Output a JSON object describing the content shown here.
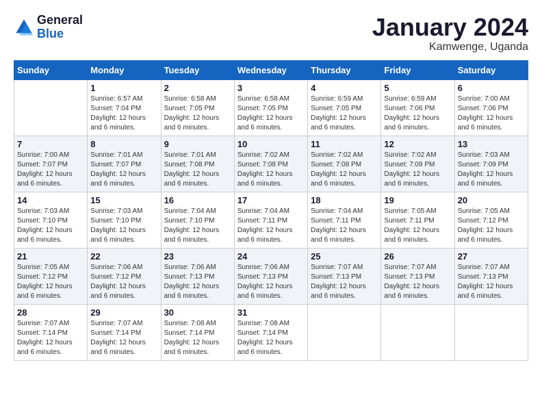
{
  "header": {
    "logo_line1": "General",
    "logo_line2": "Blue",
    "month_title": "January 2024",
    "location": "Kamwenge, Uganda"
  },
  "days_of_week": [
    "Sunday",
    "Monday",
    "Tuesday",
    "Wednesday",
    "Thursday",
    "Friday",
    "Saturday"
  ],
  "weeks": [
    [
      {
        "day": "",
        "info": ""
      },
      {
        "day": "1",
        "info": "Sunrise: 6:57 AM\nSunset: 7:04 PM\nDaylight: 12 hours\nand 6 minutes."
      },
      {
        "day": "2",
        "info": "Sunrise: 6:58 AM\nSunset: 7:05 PM\nDaylight: 12 hours\nand 6 minutes."
      },
      {
        "day": "3",
        "info": "Sunrise: 6:58 AM\nSunset: 7:05 PM\nDaylight: 12 hours\nand 6 minutes."
      },
      {
        "day": "4",
        "info": "Sunrise: 6:59 AM\nSunset: 7:05 PM\nDaylight: 12 hours\nand 6 minutes."
      },
      {
        "day": "5",
        "info": "Sunrise: 6:59 AM\nSunset: 7:06 PM\nDaylight: 12 hours\nand 6 minutes."
      },
      {
        "day": "6",
        "info": "Sunrise: 7:00 AM\nSunset: 7:06 PM\nDaylight: 12 hours\nand 6 minutes."
      }
    ],
    [
      {
        "day": "7",
        "info": "Sunrise: 7:00 AM\nSunset: 7:07 PM\nDaylight: 12 hours\nand 6 minutes."
      },
      {
        "day": "8",
        "info": "Sunrise: 7:01 AM\nSunset: 7:07 PM\nDaylight: 12 hours\nand 6 minutes."
      },
      {
        "day": "9",
        "info": "Sunrise: 7:01 AM\nSunset: 7:08 PM\nDaylight: 12 hours\nand 6 minutes."
      },
      {
        "day": "10",
        "info": "Sunrise: 7:02 AM\nSunset: 7:08 PM\nDaylight: 12 hours\nand 6 minutes."
      },
      {
        "day": "11",
        "info": "Sunrise: 7:02 AM\nSunset: 7:08 PM\nDaylight: 12 hours\nand 6 minutes."
      },
      {
        "day": "12",
        "info": "Sunrise: 7:02 AM\nSunset: 7:09 PM\nDaylight: 12 hours\nand 6 minutes."
      },
      {
        "day": "13",
        "info": "Sunrise: 7:03 AM\nSunset: 7:09 PM\nDaylight: 12 hours\nand 6 minutes."
      }
    ],
    [
      {
        "day": "14",
        "info": "Sunrise: 7:03 AM\nSunset: 7:10 PM\nDaylight: 12 hours\nand 6 minutes."
      },
      {
        "day": "15",
        "info": "Sunrise: 7:03 AM\nSunset: 7:10 PM\nDaylight: 12 hours\nand 6 minutes."
      },
      {
        "day": "16",
        "info": "Sunrise: 7:04 AM\nSunset: 7:10 PM\nDaylight: 12 hours\nand 6 minutes."
      },
      {
        "day": "17",
        "info": "Sunrise: 7:04 AM\nSunset: 7:11 PM\nDaylight: 12 hours\nand 6 minutes."
      },
      {
        "day": "18",
        "info": "Sunrise: 7:04 AM\nSunset: 7:11 PM\nDaylight: 12 hours\nand 6 minutes."
      },
      {
        "day": "19",
        "info": "Sunrise: 7:05 AM\nSunset: 7:11 PM\nDaylight: 12 hours\nand 6 minutes."
      },
      {
        "day": "20",
        "info": "Sunrise: 7:05 AM\nSunset: 7:12 PM\nDaylight: 12 hours\nand 6 minutes."
      }
    ],
    [
      {
        "day": "21",
        "info": "Sunrise: 7:05 AM\nSunset: 7:12 PM\nDaylight: 12 hours\nand 6 minutes."
      },
      {
        "day": "22",
        "info": "Sunrise: 7:06 AM\nSunset: 7:12 PM\nDaylight: 12 hours\nand 6 minutes."
      },
      {
        "day": "23",
        "info": "Sunrise: 7:06 AM\nSunset: 7:13 PM\nDaylight: 12 hours\nand 6 minutes."
      },
      {
        "day": "24",
        "info": "Sunrise: 7:06 AM\nSunset: 7:13 PM\nDaylight: 12 hours\nand 6 minutes."
      },
      {
        "day": "25",
        "info": "Sunrise: 7:07 AM\nSunset: 7:13 PM\nDaylight: 12 hours\nand 6 minutes."
      },
      {
        "day": "26",
        "info": "Sunrise: 7:07 AM\nSunset: 7:13 PM\nDaylight: 12 hours\nand 6 minutes."
      },
      {
        "day": "27",
        "info": "Sunrise: 7:07 AM\nSunset: 7:13 PM\nDaylight: 12 hours\nand 6 minutes."
      }
    ],
    [
      {
        "day": "28",
        "info": "Sunrise: 7:07 AM\nSunset: 7:14 PM\nDaylight: 12 hours\nand 6 minutes."
      },
      {
        "day": "29",
        "info": "Sunrise: 7:07 AM\nSunset: 7:14 PM\nDaylight: 12 hours\nand 6 minutes."
      },
      {
        "day": "30",
        "info": "Sunrise: 7:08 AM\nSunset: 7:14 PM\nDaylight: 12 hours\nand 6 minutes."
      },
      {
        "day": "31",
        "info": "Sunrise: 7:08 AM\nSunset: 7:14 PM\nDaylight: 12 hours\nand 6 minutes."
      },
      {
        "day": "",
        "info": ""
      },
      {
        "day": "",
        "info": ""
      },
      {
        "day": "",
        "info": ""
      }
    ]
  ]
}
